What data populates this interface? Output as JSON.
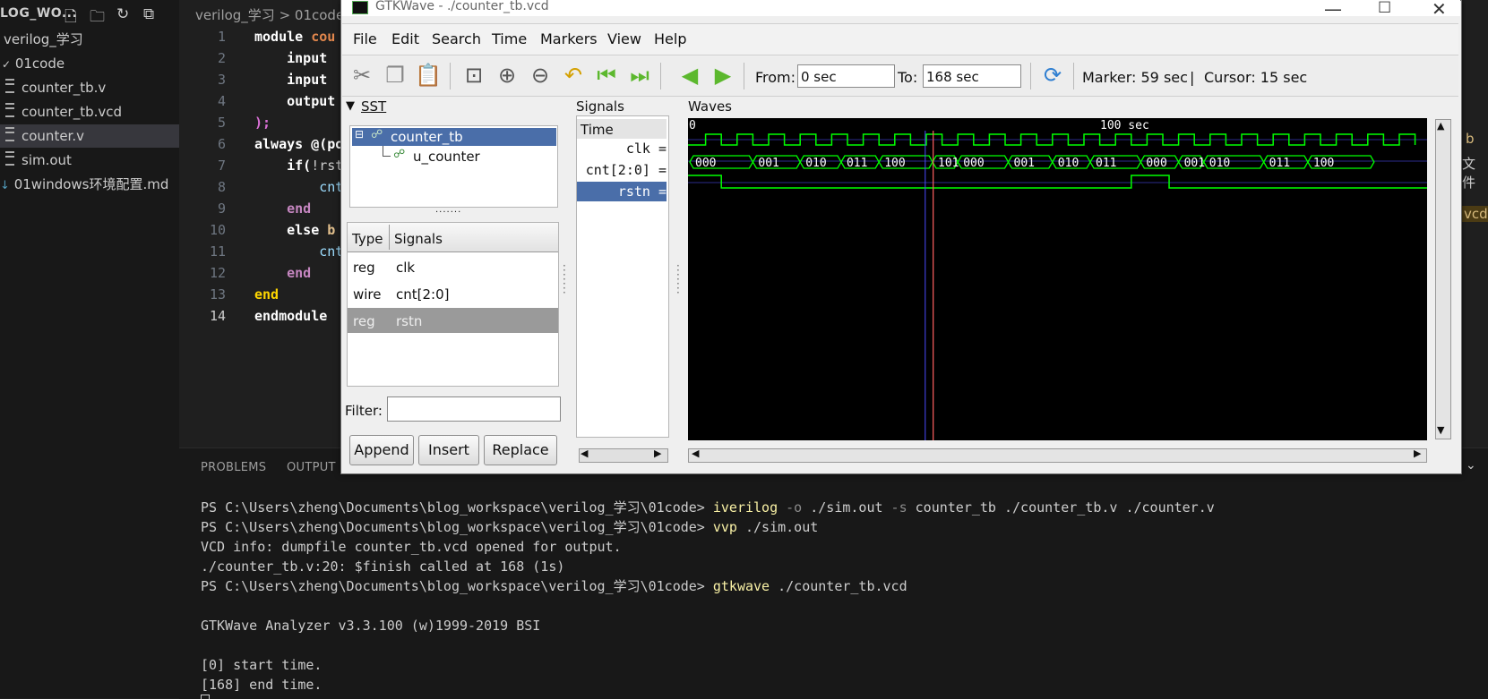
{
  "explorer": {
    "title": "LOG_WO...",
    "items": [
      {
        "label": "verilog_学习",
        "indent": 1,
        "kind": "folder"
      },
      {
        "label": "01code",
        "indent": 2,
        "kind": "folder-open"
      },
      {
        "label": "counter_tb.v",
        "indent": 3,
        "kind": "file"
      },
      {
        "label": "counter_tb.vcd",
        "indent": 3,
        "kind": "file"
      },
      {
        "label": "counter.v",
        "indent": 3,
        "kind": "file",
        "selected": true
      },
      {
        "label": "sim.out",
        "indent": 3,
        "kind": "file"
      },
      {
        "label": "01windows环境配置.md",
        "indent": 2,
        "kind": "md"
      }
    ]
  },
  "editor": {
    "breadcrumb": "verilog_学习 > 01code",
    "lines": [
      "1",
      "2",
      "3",
      "4",
      "5",
      "6",
      "7",
      "8",
      "9",
      "10",
      "11",
      "12",
      "13",
      "14"
    ],
    "code": {
      "l1a": "module ",
      "l1b": "cou",
      "l2": "    input",
      "l3": "    input",
      "l4": "    output",
      "l5": ");",
      "l6a": "always @(",
      "l6b": "po",
      "l7a": "    if(",
      "l7b": "!rst",
      "l8": "        cnt",
      "l9": "    end",
      "l10a": "    else ",
      "l10b": "b",
      "l11": "        cnt",
      "l12": "    end",
      "l13": "end",
      "l14": "endmodule"
    },
    "right_fragments": {
      "b": "b",
      "wenjian": "文件",
      "vcd": "vcd"
    }
  },
  "panel": {
    "tabs": [
      "PROBLEMS",
      "OUTPUT"
    ],
    "terminal": {
      "prompt": "PS C:\\Users\\zheng\\Documents\\blog_workspace\\verilog_学习\\01code> ",
      "cmd1_exe": "iverilog",
      "cmd1_f1": " -o",
      "cmd1_a1": " ./sim.out",
      "cmd1_f2": " -s",
      "cmd1_a2": " counter_tb ./counter_tb.v ./counter.v",
      "cmd2_exe": "vvp",
      "cmd2_a": " ./sim.out",
      "out1": "VCD info: dumpfile counter_tb.vcd opened for output.",
      "out2": "./counter_tb.v:20: $finish called at 168 (1s)",
      "cmd3_exe": "gtkwave",
      "cmd3_a": " ./counter_tb.vcd",
      "out3": "GTKWave Analyzer v3.3.100 (w)1999-2019 BSI",
      "out4": "[0] start time.",
      "out5": "[168] end time."
    }
  },
  "gtkwave": {
    "title": "GTKWave - ./counter_tb.vcd",
    "menu": [
      "File",
      "Edit",
      "Search",
      "Time",
      "Markers",
      "View",
      "Help"
    ],
    "toolbar": {
      "from_label": "From:",
      "from_value": "0 sec",
      "to_label": "To:",
      "to_value": "168 sec",
      "marker": "Marker: 59 sec",
      "sep": "|",
      "cursor": "Cursor: 15 sec"
    },
    "sst": {
      "title": "SST",
      "tree_root": "counter_tb",
      "tree_child": "u_counter",
      "col_type": "Type",
      "col_signals": "Signals",
      "rows": [
        {
          "type": "reg",
          "name": "clk"
        },
        {
          "type": "wire",
          "name": "cnt[2:0]"
        },
        {
          "type": "reg",
          "name": "rstn",
          "selected": true
        }
      ],
      "filter_label": "Filter:",
      "buttons": [
        "Append",
        "Insert",
        "Replace"
      ]
    },
    "signals": {
      "title": "Signals",
      "time_header": "Time",
      "rows": [
        "clk =",
        "cnt[2:0] =",
        "rstn ="
      ]
    },
    "waves": {
      "title": "Waves",
      "time_start": "0",
      "time_mid": "100 sec",
      "cnt_values": [
        "000",
        "001",
        "010",
        "011",
        "100",
        "101",
        "000",
        "001",
        "010",
        "011",
        "000",
        "001",
        "010",
        "011",
        "100"
      ],
      "marker_time": 59,
      "cursor_time": 15
    },
    "colors": {
      "wave": "#00ff00",
      "marker": "#ff6060",
      "cursor": "#4a4aff",
      "wave_bg": "#000000"
    }
  }
}
